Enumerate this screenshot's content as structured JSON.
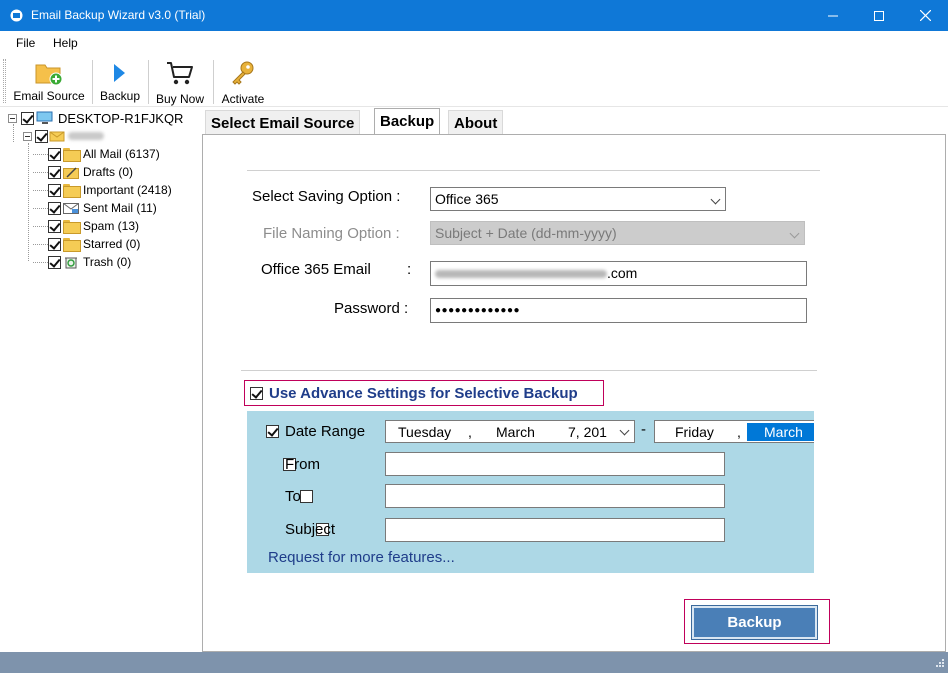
{
  "window": {
    "title": "Email Backup Wizard v3.0 (Trial)",
    "colors": {
      "titlebar": "#0f78d7",
      "accent_border": "#c0005a",
      "panel_blue": "#add8e6",
      "button_blue": "#4a7fb7",
      "status_bar": "#7e93ac"
    }
  },
  "menu": {
    "file": "File",
    "help": "Help"
  },
  "toolbar": {
    "email_source": "Email Source",
    "backup": "Backup",
    "buy_now": "Buy Now",
    "activate": "Activate"
  },
  "tree": {
    "root": "DESKTOP-R1FJKQR",
    "folders": [
      {
        "label": "All Mail (6137)",
        "icon": "folder-icon"
      },
      {
        "label": "Drafts (0)",
        "icon": "drafts-folder-icon"
      },
      {
        "label": "Important (2418)",
        "icon": "folder-icon"
      },
      {
        "label": "Sent Mail (11)",
        "icon": "sent-mail-icon"
      },
      {
        "label": "Spam (13)",
        "icon": "folder-icon"
      },
      {
        "label": "Starred (0)",
        "icon": "folder-icon"
      },
      {
        "label": "Trash (0)",
        "icon": "trash-icon"
      }
    ]
  },
  "tabs": {
    "select_email_source": "Select Email Source",
    "backup": "Backup",
    "about": "About"
  },
  "form": {
    "saving_option_label": "Select Saving Option :",
    "saving_option_value": "Office 365",
    "file_naming_label": "File Naming Option :",
    "file_naming_value": "Subject + Date (dd-mm-yyyy)",
    "email_label": "Office 365 Email",
    "email_colon": ":",
    "email_value_suffix": ".com",
    "password_label": "Password :",
    "password_value": "●●●●●●●●●●●●●"
  },
  "advanced": {
    "toggle_label": "Use Advance Settings for Selective Backup",
    "date_range_label": "Date Range",
    "from_date": {
      "weekday": "Tuesday",
      "comma": ",",
      "month": "March",
      "day": "7, 201"
    },
    "dash": "-",
    "to_date": {
      "weekday": "Friday",
      "comma": ",",
      "month": "March"
    },
    "from_label": "From",
    "to_label": "To",
    "subject_label": "Subject",
    "request_link": "Request for more features..."
  },
  "actions": {
    "backup_button": "Backup"
  }
}
